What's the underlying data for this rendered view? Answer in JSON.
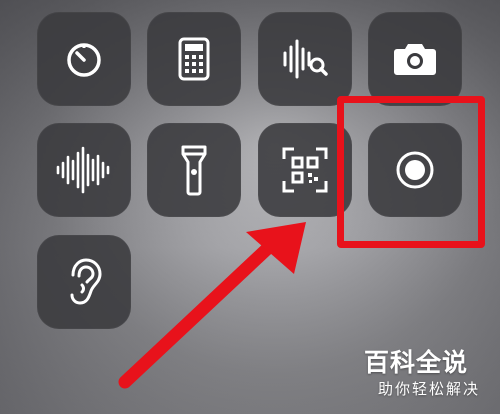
{
  "control_center": {
    "controls": [
      {
        "name": "timer",
        "icon": "timer-icon"
      },
      {
        "name": "calculator",
        "icon": "calculator-icon"
      },
      {
        "name": "sound-recognition",
        "icon": "sound-recognition-icon"
      },
      {
        "name": "camera",
        "icon": "camera-icon"
      },
      {
        "name": "voice-memos",
        "icon": "waveform-icon"
      },
      {
        "name": "flashlight",
        "icon": "flashlight-icon"
      },
      {
        "name": "code-scanner",
        "icon": "qr-scan-icon"
      },
      {
        "name": "screen-recording",
        "icon": "record-icon"
      },
      {
        "name": "hearing",
        "icon": "ear-icon"
      }
    ]
  },
  "annotation": {
    "color": "#e8121b",
    "target": "screen-recording"
  },
  "watermark": {
    "title": "百科全说",
    "subtitle": "助你轻松解决"
  }
}
